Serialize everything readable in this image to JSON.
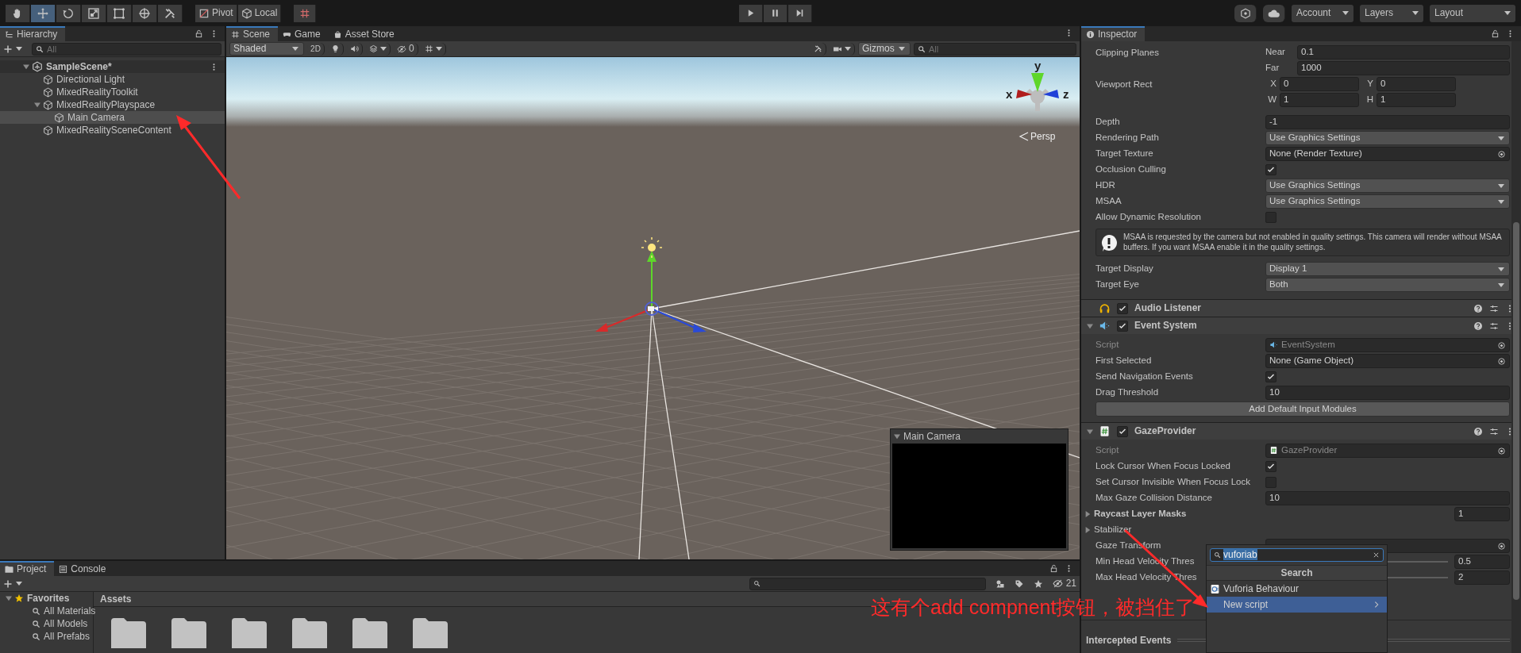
{
  "toolbar": {
    "tools": [
      {
        "kind": "hand",
        "selected": false
      },
      {
        "kind": "move",
        "selected": true
      },
      {
        "kind": "rotate",
        "selected": false
      },
      {
        "kind": "scale",
        "selected": false
      },
      {
        "kind": "rect",
        "selected": false
      },
      {
        "kind": "transform",
        "selected": false
      },
      {
        "kind": "custom",
        "selected": false
      }
    ],
    "pivot": "Pivot",
    "space": "Local",
    "menus": [
      "Account",
      "Layers",
      "Layout"
    ]
  },
  "hierarchy": {
    "tab": "Hierarchy",
    "search_placeholder": "All",
    "scene": {
      "label": "SampleScene*",
      "expanded": true,
      "children": [
        {
          "label": "Directional Light",
          "selected": false
        },
        {
          "label": "MixedRealityToolkit",
          "selected": false
        },
        {
          "label": "MixedRealityPlayspace",
          "selected": false,
          "expanded": true,
          "children": [
            {
              "label": "Main Camera",
              "selected": true
            }
          ]
        },
        {
          "label": "MixedRealitySceneContent",
          "selected": false
        }
      ]
    }
  },
  "scene_view": {
    "tabs": [
      {
        "label": "Scene",
        "kind": "scene",
        "selected": true
      },
      {
        "label": "Game",
        "kind": "game",
        "selected": false
      },
      {
        "label": "Asset Store",
        "kind": "store",
        "selected": false
      }
    ],
    "shading": "Shaded",
    "mode_2d": "2D",
    "hidden_count": "0",
    "gizmos": "Gizmos",
    "search_placeholder": "All",
    "axes": [
      "x",
      "y",
      "z"
    ],
    "projection": "Persp",
    "preview": {
      "title": "Main Camera"
    }
  },
  "inspector": {
    "tab": "Inspector",
    "camera_rows": [
      {
        "kind": "pair",
        "label": "Clipping Planes",
        "fields": [
          {
            "label": "Near",
            "value": "0.1"
          },
          {
            "label": "Far",
            "value": "1000"
          }
        ]
      },
      {
        "kind": "rect",
        "label": "Viewport Rect",
        "fields": [
          {
            "label": "X",
            "value": "0"
          },
          {
            "label": "Y",
            "value": "0"
          },
          {
            "label": "W",
            "value": "1"
          },
          {
            "label": "H",
            "value": "1"
          }
        ]
      },
      {
        "kind": "number",
        "label": "Depth",
        "value": "-1"
      },
      {
        "kind": "dropdown",
        "label": "Rendering Path",
        "value": "Use Graphics Settings"
      },
      {
        "kind": "object",
        "label": "Target Texture",
        "value": "None (Render Texture)"
      },
      {
        "kind": "checkbox",
        "label": "Occlusion Culling",
        "checked": true
      },
      {
        "kind": "dropdown",
        "label": "HDR",
        "value": "Use Graphics Settings"
      },
      {
        "kind": "dropdown",
        "label": "MSAA",
        "value": "Use Graphics Settings"
      },
      {
        "kind": "checkbox",
        "label": "Allow Dynamic Resolution",
        "checked": false
      },
      {
        "kind": "help",
        "text": "MSAA is requested by the camera but not enabled in quality settings. This camera will render without MSAA buffers. If you want MSAA enable it in the quality settings."
      },
      {
        "kind": "dropdown",
        "label": "Target Display",
        "value": "Display 1"
      },
      {
        "kind": "dropdown",
        "label": "Target Eye",
        "value": "Both"
      }
    ],
    "components": [
      {
        "name": "Audio Listener",
        "kind": "audio",
        "enabled": true
      },
      {
        "name": "Event System",
        "kind": "event",
        "enabled": true,
        "expanded": true,
        "rows": [
          {
            "kind": "script",
            "label": "Script",
            "value": "EventSystem",
            "disabled": true
          },
          {
            "kind": "object",
            "label": "First Selected",
            "value": "None (Game Object)"
          },
          {
            "kind": "checkbox",
            "label": "Send Navigation Events",
            "checked": true
          },
          {
            "kind": "number",
            "label": "Drag Threshold",
            "value": "10"
          },
          {
            "kind": "button",
            "label": "Add Default Input Modules"
          }
        ]
      },
      {
        "name": "GazeProvider",
        "kind": "script",
        "enabled": true,
        "expanded": true,
        "rows": [
          {
            "kind": "script",
            "label": "Script",
            "value": "GazeProvider",
            "disabled": true
          },
          {
            "kind": "checkbox",
            "label": "Lock Cursor When Focus Locked",
            "checked": true
          },
          {
            "kind": "checkbox",
            "label": "Set Cursor Invisible When Focus Lock",
            "checked": false
          },
          {
            "kind": "number",
            "label": "Max Gaze Collision Distance",
            "value": "10"
          },
          {
            "kind": "array",
            "label": "Raycast Layer Masks",
            "expanded": false,
            "value": "1"
          },
          {
            "kind": "foldout",
            "label": "Stabilizer",
            "expanded": false
          },
          {
            "kind": "object",
            "label": "Gaze Transform"
          },
          {
            "kind": "slider",
            "label": "Min Head Velocity Thres",
            "value": "0.5"
          },
          {
            "kind": "slider",
            "label": "Max Head Velocity Thres",
            "value": "2"
          }
        ]
      }
    ],
    "footer": "Intercepted Events"
  },
  "project": {
    "tabs": [
      {
        "label": "Project",
        "kind": "project",
        "selected": true
      },
      {
        "label": "Console",
        "kind": "console",
        "selected": false
      }
    ],
    "hidden_count": "21",
    "favorites": {
      "label": "Favorites",
      "expanded": true,
      "children": [
        {
          "label": "All Materials"
        },
        {
          "label": "All Models"
        },
        {
          "label": "All Prefabs"
        }
      ]
    },
    "folder_title": "Assets",
    "assets": [
      {
        "kind": "folder"
      },
      {
        "kind": "folder"
      },
      {
        "kind": "folder"
      },
      {
        "kind": "folder"
      },
      {
        "kind": "folder"
      },
      {
        "kind": "folder"
      }
    ]
  },
  "component_menu": {
    "search": "vuforiab",
    "header": "Search",
    "items": [
      {
        "label": "Vuforia Behaviour",
        "kind": "script",
        "selected": false
      },
      {
        "label": "New script",
        "kind": "submenu",
        "selected": true
      }
    ]
  },
  "annotation": {
    "text": "这有个add compnent按钮，被挡住了"
  }
}
